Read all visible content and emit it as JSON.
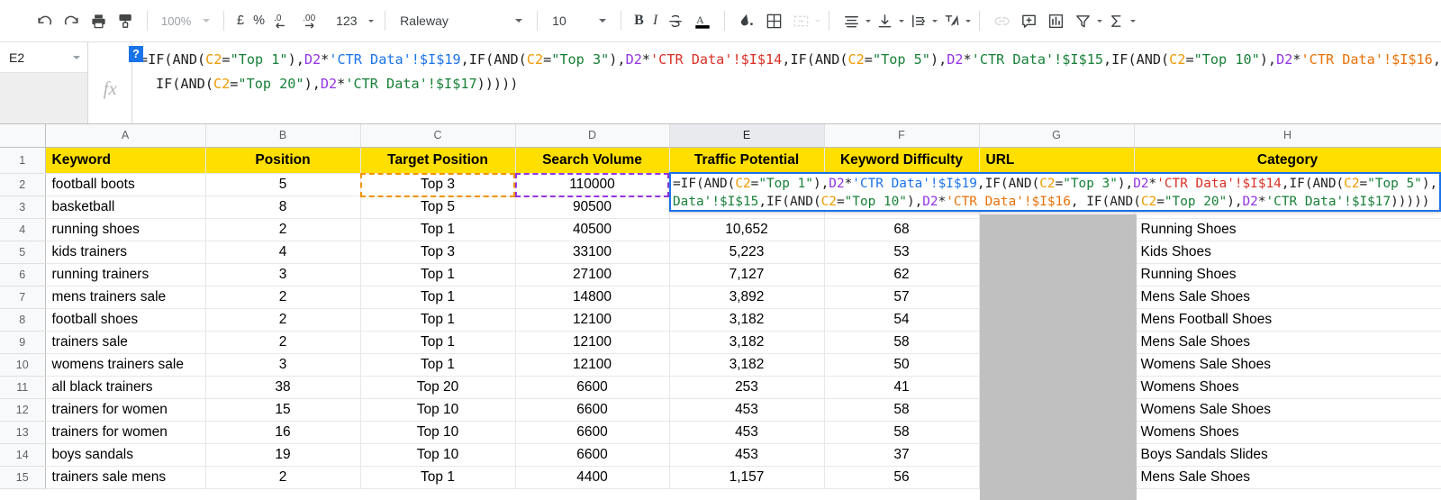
{
  "toolbar": {
    "zoom": "100%",
    "currency": "£",
    "percent": "%",
    "decrease_decimal": ".0",
    "increase_decimal": ".00",
    "number_format": "123",
    "font_family": "Raleway",
    "font_size": "10",
    "bold": "B",
    "italic": "I",
    "icons": [
      "undo-icon",
      "redo-icon",
      "print-icon",
      "paint-format-icon",
      "fill-color-icon",
      "borders-icon",
      "merge-cells-icon",
      "horizontal-align-icon",
      "vertical-align-icon",
      "text-wrapping-icon",
      "text-rotation-icon",
      "insert-link-icon",
      "insert-comment-icon",
      "insert-chart-icon",
      "filter-icon",
      "sum-icon",
      "strikethrough-icon",
      "text-color-icon"
    ]
  },
  "formula_bar": {
    "cell_reference": "E2",
    "fx_label": "fx",
    "help_badge": "?",
    "formula_line_1": "=IF(AND(C2=\"Top 1\"),D2*'CTR Data'!$I$19,IF(AND(C2=\"Top 3\"),D2*'CTR Data'!$I$14,IF(AND(C2=\"Top 5\"),D2*'CTR Data'!$I$15,IF(AND(C2=\"Top 10\"),D2*'CTR Data'!$I$16,",
    "formula_line_2": "IF(AND(C2=\"Top 20\"),D2*'CTR Data'!$I$17)))))"
  },
  "cell_editor": {
    "target_cell": "E2",
    "line_1": "=IF(AND(C2=\"Top 1\"),D2*'CTR Data'!$I$19,IF(AND(C2=\"Top 3\"),D2*'CTR Data'!$I$14,IF(AND(C2=\"Top 5\"),",
    "line_2": "Data'!$I$15,IF(AND(C2=\"Top 10\"),D2*'CTR Data'!$I$16, IF(AND(C2=\"Top 20\"),D2*'CTR Data'!$I$17)))))"
  },
  "colors": {
    "header_fill": "#ffdf00",
    "selection_blue": "#1a73e8",
    "ref_c2_orange": "#f09300",
    "ref_d2_purple": "#9334e6",
    "url_link": "#1155cc",
    "redaction_gray": "#c0c0c0"
  },
  "grid": {
    "columns": [
      "A",
      "B",
      "C",
      "D",
      "E",
      "F",
      "G",
      "H"
    ],
    "row_numbers": [
      "1",
      "2",
      "3",
      "4",
      "5",
      "6",
      "7",
      "8",
      "9",
      "10",
      "11",
      "12",
      "13",
      "14",
      "15"
    ],
    "headers": [
      "Keyword",
      "Position",
      "Target Position",
      "Search Volume",
      "Traffic Potential",
      "Keyword Difficulty",
      "URL",
      "Category"
    ],
    "header_align": [
      "left",
      "center",
      "center",
      "center",
      "center",
      "center",
      "left",
      "center"
    ],
    "rows": [
      {
        "row": "2",
        "keyword": "football boots",
        "position": "5",
        "target_position": "Top 3",
        "search_volume": "110000",
        "traffic_potential": "",
        "keyword_difficulty": "",
        "url": "",
        "category": ""
      },
      {
        "row": "3",
        "keyword": "basketball",
        "position": "8",
        "target_position": "Top 5",
        "search_volume": "90500",
        "traffic_potential": "",
        "keyword_difficulty": "",
        "url": "",
        "category": ""
      },
      {
        "row": "4",
        "keyword": "running shoes",
        "position": "2",
        "target_position": "Top 1",
        "search_volume": "40500",
        "traffic_potential": "10,652",
        "keyword_difficulty": "68",
        "url": "",
        "category": "Running Shoes"
      },
      {
        "row": "5",
        "keyword": "kids trainers",
        "position": "4",
        "target_position": "Top 3",
        "search_volume": "33100",
        "traffic_potential": "5,223",
        "keyword_difficulty": "53",
        "url": "",
        "category": "Kids Shoes"
      },
      {
        "row": "6",
        "keyword": "running trainers",
        "position": "3",
        "target_position": "Top 1",
        "search_volume": "27100",
        "traffic_potential": "7,127",
        "keyword_difficulty": "62",
        "url": "",
        "category": "Running Shoes"
      },
      {
        "row": "7",
        "keyword": "mens trainers sale",
        "position": "2",
        "target_position": "Top 1",
        "search_volume": "14800",
        "traffic_potential": "3,892",
        "keyword_difficulty": "57",
        "url": "",
        "category": "Mens Sale Shoes"
      },
      {
        "row": "8",
        "keyword": "football shoes",
        "position": "2",
        "target_position": "Top 1",
        "search_volume": "12100",
        "traffic_potential": "3,182",
        "keyword_difficulty": "54",
        "url": "",
        "category": "Mens Football Shoes"
      },
      {
        "row": "9",
        "keyword": "trainers sale",
        "position": "2",
        "target_position": "Top 1",
        "search_volume": "12100",
        "traffic_potential": "3,182",
        "keyword_difficulty": "58",
        "url": "",
        "category": "Mens Sale Shoes"
      },
      {
        "row": "10",
        "keyword": "womens trainers sale",
        "position": "3",
        "target_position": "Top 1",
        "search_volume": "12100",
        "traffic_potential": "3,182",
        "keyword_difficulty": "50",
        "url": "",
        "category": "Womens Sale Shoes"
      },
      {
        "row": "11",
        "keyword": "all black trainers",
        "position": "38",
        "target_position": "Top 20",
        "search_volume": "6600",
        "traffic_potential": "253",
        "keyword_difficulty": "41",
        "url": "",
        "category": "Womens Shoes"
      },
      {
        "row": "12",
        "keyword": "trainers for women",
        "position": "15",
        "target_position": "Top 10",
        "search_volume": "6600",
        "traffic_potential": "453",
        "keyword_difficulty": "58",
        "url": "",
        "category": "Womens Sale Shoes"
      },
      {
        "row": "13",
        "keyword": "trainers for women",
        "position": "16",
        "target_position": "Top 10",
        "search_volume": "6600",
        "traffic_potential": "453",
        "keyword_difficulty": "58",
        "url": "",
        "category": "Womens Shoes"
      },
      {
        "row": "14",
        "keyword": "boys sandals",
        "position": "19",
        "target_position": "Top 10",
        "search_volume": "6600",
        "traffic_potential": "453",
        "keyword_difficulty": "37",
        "url": "",
        "category": "Boys Sandals Slides"
      },
      {
        "row": "15",
        "keyword": "trainers sale mens",
        "position": "2",
        "target_position": "Top 1",
        "search_volume": "4400",
        "traffic_potential": "1,157",
        "keyword_difficulty": "56",
        "url": "",
        "category": "Mens Sale Shoes"
      }
    ]
  }
}
